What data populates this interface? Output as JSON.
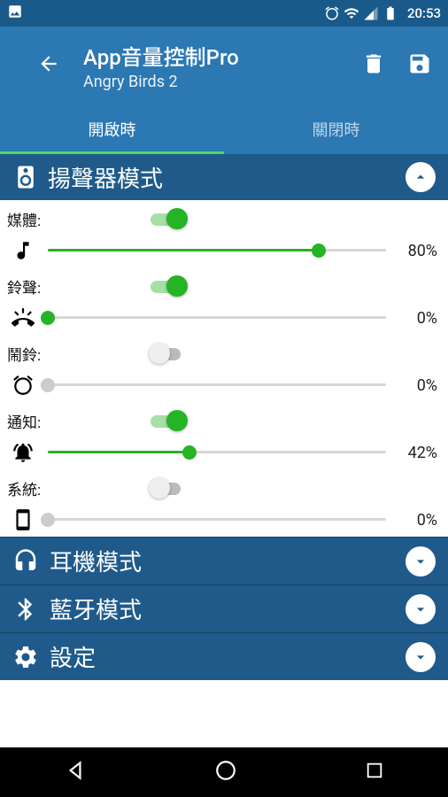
{
  "status": {
    "time": "20:53"
  },
  "appbar": {
    "title": "App音量控制Pro",
    "subtitle": "Angry Birds 2"
  },
  "tabs": {
    "open": "開啟時",
    "close": "關閉時"
  },
  "sections": {
    "speaker": "揚聲器模式",
    "headphone": "耳機模式",
    "bluetooth": "藍牙模式",
    "settings": "設定"
  },
  "vol": {
    "media": {
      "label": "媒體:",
      "pct": "80%",
      "on": true,
      "val": 80
    },
    "ring": {
      "label": "鈴聲:",
      "pct": "0%",
      "on": true,
      "val": 0
    },
    "alarm": {
      "label": "鬧鈴:",
      "pct": "0%",
      "on": false,
      "val": 0
    },
    "notif": {
      "label": "通知:",
      "pct": "42%",
      "on": true,
      "val": 42
    },
    "system": {
      "label": "系統:",
      "pct": "0%",
      "on": false,
      "val": 0
    }
  }
}
